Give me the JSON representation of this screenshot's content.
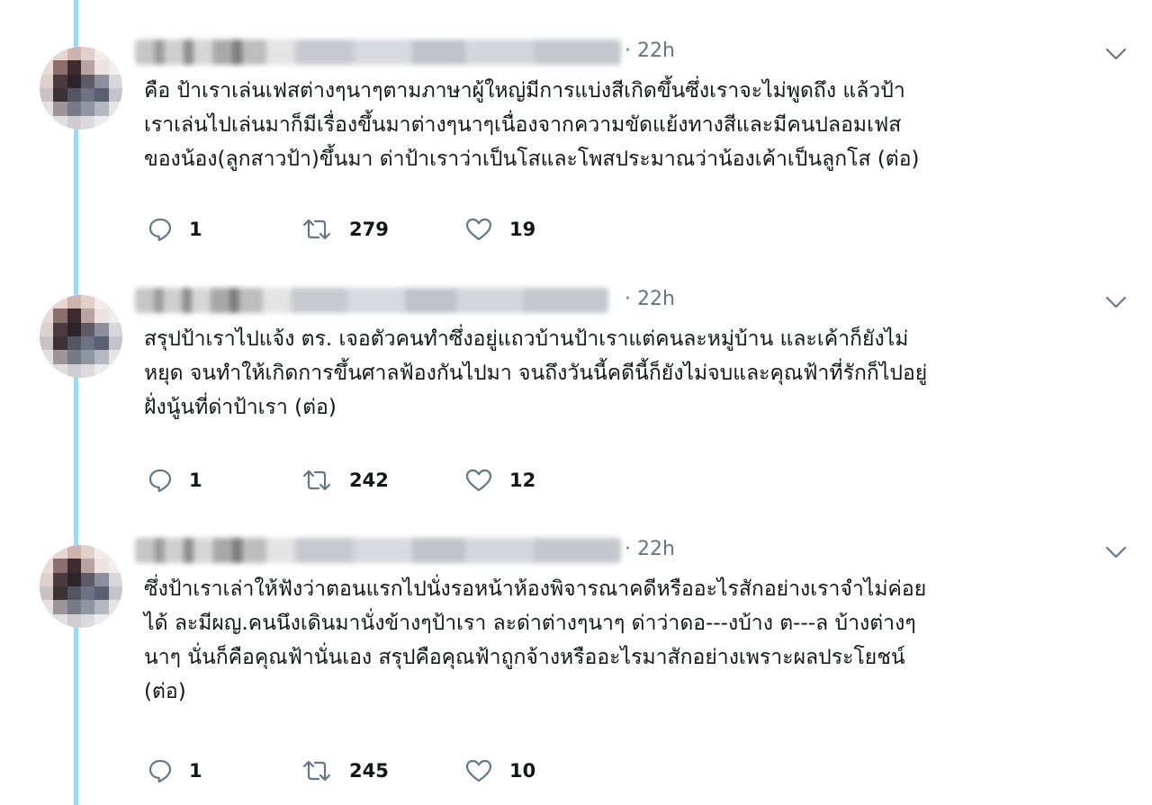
{
  "thread": {
    "tweets": [
      {
        "time": "· 22h",
        "lines": [
          "คือ ป้าเราเล่นเฟสต่างๆนาๆตามภาษาผู้ใหญ่มีการแบ่งสีเกิดขึ้นซึ่งเราจะไม่พูดถึง แล้วป้า",
          "เราเล่นไปเล่นมาก็มีเรื่องขึ้นมาต่างๆนาๆเนื่องจากความขัดแย้งทางสีและมีคนปลอมเฟส",
          "ของน้อง(ลูกสาวป้า)ขึ้นมา ด่าป้าเราว่าเป็นโสและโพสประมาณว่าน้องเค้าเป็นลูกโส (ต่อ)"
        ],
        "replies": "1",
        "retweets": "279",
        "likes": "19"
      },
      {
        "time": "· 22h",
        "lines": [
          "สรุปป้าเราไปแจ้ง ตร. เจอตัวคนทำซึ่งอยู่แถวบ้านป้าเราแต่คนละหมู่บ้าน และเค้าก็ยังไม่",
          "หยุด จนทำให้เกิดการขึ้นศาลฟ้องกันไปมา จนถึงวันนี้คดีนี้ก็ยังไม่จบและคุณฟ้าที่รักก็ไปอยู่",
          "ฝั่งนู้นที่ด่าป้าเรา (ต่อ)"
        ],
        "replies": "1",
        "retweets": "242",
        "likes": "12"
      },
      {
        "time": "· 22h",
        "lines": [
          "ซึ่งป้าเราเล่าให้ฟังว่าตอนแรกไปนั่งรอหน้าห้องพิจารณาคดีหรืออะไรสักอย่างเราจำไม่ค่อย",
          "ได้ ละมีผญ.คนนึงเดินมานั่งข้างๆป้าเรา ละด่าต่างๆนาๆ ด่าว่าดอ---งบ้าง ต---ล บ้างต่างๆ",
          "นาๆ นั่นก็คือคุณฟ้านั่นเอง สรุปคือคุณฟ้าถูกจ้างหรืออะไรมาสักอย่างเพราะผลประโยชน์",
          "(ต่อ)"
        ],
        "replies": "1",
        "retweets": "245",
        "likes": "10"
      }
    ]
  },
  "icons": {
    "reply": "reply-icon",
    "retweet": "retweet-icon",
    "like": "heart-icon",
    "more": "chevron-down-icon"
  },
  "colors": {
    "thread_line": "#9fd7f7",
    "secondary_text": "#657786",
    "icon": "#657786"
  }
}
